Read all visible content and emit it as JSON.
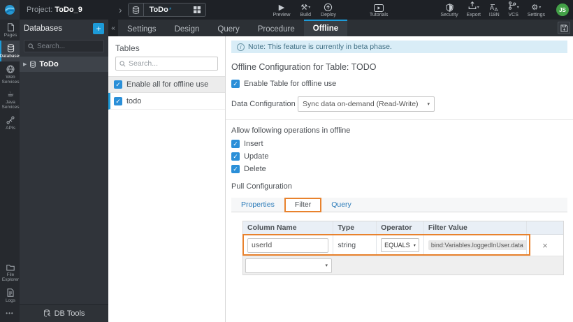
{
  "icons": {
    "check": "✓",
    "caret": "▾",
    "collapse": "«",
    "chevron": "›",
    "plus": "+",
    "close": "×",
    "expand": "▶",
    "preview": "▶",
    "build": "⚒",
    "gear": "⚙",
    "coffee": "☕",
    "more": "•••",
    "question": "?",
    "info": "i"
  },
  "colors": {
    "accent": "#1d9bd8",
    "annotation": "#e8822d",
    "note_bg": "#d9edf7",
    "avatar_bg": "#43a047"
  },
  "topbar": {
    "project_label": "Project:",
    "project_name": "ToDo_9",
    "app": {
      "name": "ToDo",
      "modified": "*"
    },
    "preview": "Preview",
    "build": "Build",
    "deploy": "Deploy",
    "tutorials": "Tutorials",
    "security": "Security",
    "export": "Export",
    "i18n": "I18N",
    "vcs": "VCS",
    "settings": "Settings",
    "avatar": "JS"
  },
  "sidebar": {
    "items": [
      "Pages",
      "Databases",
      "Web Services",
      "Java Services",
      "APIs"
    ],
    "file_explorer": "File Explorer",
    "logs": "Logs"
  },
  "db_panel": {
    "title": "Databases",
    "search_placeholder": "Search...",
    "database": "ToDo",
    "footer": "DB Tools"
  },
  "editor_tabs": {
    "items": [
      "Settings",
      "Design",
      "Query",
      "Procedure",
      "Offline"
    ],
    "active": "Offline"
  },
  "tables_panel": {
    "title": "Tables",
    "search_placeholder": "Search...",
    "enable_all": "Enable all for offline use",
    "table": "todo"
  },
  "offline": {
    "note": "Note: This feature is currently in beta phase.",
    "title": "Offline Configuration for Table: TODO",
    "enable_table": "Enable Table for offline use",
    "data_config_label": "Data Configuration",
    "data_config_value": "Sync data on-demand (Read-Write)",
    "allow_label": "Allow following operations in offline",
    "op_insert": "Insert",
    "op_update": "Update",
    "op_delete": "Delete",
    "pull_label": "Pull Configuration",
    "pull_tabs": [
      "Properties",
      "Filter",
      "Query"
    ],
    "pull_active": "Filter",
    "filter_table": {
      "headers": [
        "Column Name",
        "Type",
        "Operator",
        "Filter Value"
      ],
      "row": {
        "column_name": "userId",
        "type": "string",
        "operator": "EQUALS",
        "filter_value": "bind:Variables.loggedInUser.data"
      }
    }
  }
}
